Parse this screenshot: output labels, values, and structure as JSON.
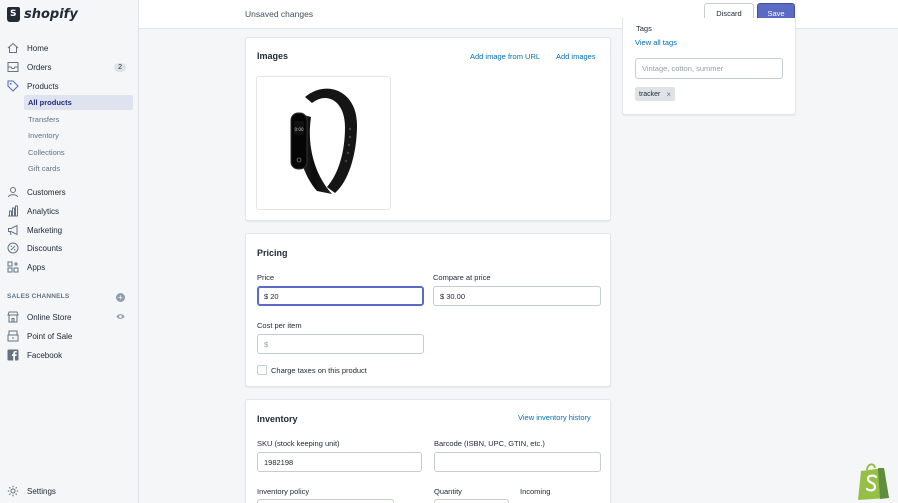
{
  "app": {
    "brand": "shopify"
  },
  "sidebar": {
    "items": [
      {
        "label": "Home",
        "icon": "home-icon"
      },
      {
        "label": "Orders",
        "icon": "orders-icon",
        "badge": "2"
      },
      {
        "label": "Products",
        "icon": "tag-icon"
      },
      {
        "label": "Customers",
        "icon": "person-icon"
      },
      {
        "label": "Analytics",
        "icon": "bar-chart-icon"
      },
      {
        "label": "Marketing",
        "icon": "megaphone-icon"
      },
      {
        "label": "Discounts",
        "icon": "discount-icon"
      },
      {
        "label": "Apps",
        "icon": "apps-icon"
      }
    ],
    "product_subitems": [
      "All products",
      "Transfers",
      "Inventory",
      "Collections",
      "Gift cards"
    ],
    "sales_channels_heading": "SALES CHANNELS",
    "channels": [
      {
        "label": "Online Store",
        "icon": "store-icon"
      },
      {
        "label": "Point of Sale",
        "icon": "pos-icon"
      },
      {
        "label": "Facebook",
        "icon": "facebook-icon"
      }
    ],
    "settings": "Settings"
  },
  "topbar": {
    "title": "Unsaved changes",
    "discard_label": "Discard",
    "save_label": "Save"
  },
  "images_card": {
    "title": "Images",
    "add_from_url": "Add image from URL",
    "add_images": "Add images"
  },
  "pricing_card": {
    "title": "Pricing",
    "price_label": "Price",
    "price_value": "$ 20",
    "compare_label": "Compare at price",
    "compare_value": "$ 30.00",
    "cost_label": "Cost per item",
    "cost_placeholder": "$",
    "charge_taxes_label": "Charge taxes on this product"
  },
  "inventory_card": {
    "title": "Inventory",
    "history_link": "View inventory history",
    "sku_label": "SKU (stock keeping unit)",
    "sku_value": "1982198",
    "barcode_label": "Barcode (ISBN, UPC, GTIN, etc.)",
    "barcode_value": "",
    "policy_label": "Inventory policy",
    "quantity_label": "Quantity",
    "incoming_label": "Incoming"
  },
  "tags_card": {
    "title": "Tags",
    "view_all": "View all tags",
    "placeholder": "Vintage, cotton, summer",
    "tags": [
      "tracker"
    ]
  },
  "colors": {
    "accent": "#5c6ac4",
    "link": "#006fbb",
    "active_nav": "#202e78",
    "shopify_green": "#95bf47"
  }
}
